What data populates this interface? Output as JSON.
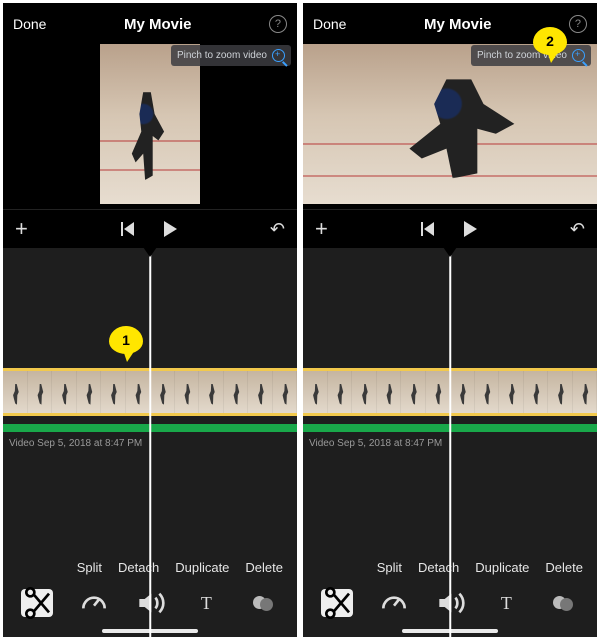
{
  "left": {
    "header": {
      "done": "Done",
      "title": "My Movie"
    },
    "preview": {
      "zoom_hint": "Pinch to zoom video",
      "orientation": "portrait"
    },
    "callout": {
      "num": "1"
    },
    "clip": {
      "meta": "Video Sep 5, 2018 at 8:47 PM"
    },
    "actions": {
      "split": "Split",
      "detach": "Detach",
      "duplicate": "Duplicate",
      "delete": "Delete"
    },
    "tools": {
      "text_tool": "T"
    }
  },
  "right": {
    "header": {
      "done": "Done",
      "title": "My Movie"
    },
    "preview": {
      "zoom_hint": "Pinch to zoom video",
      "orientation": "landscape"
    },
    "callout": {
      "num": "2"
    },
    "clip": {
      "meta": "Video Sep 5, 2018 at 8:47 PM"
    },
    "actions": {
      "split": "Split",
      "detach": "Detach",
      "duplicate": "Duplicate",
      "delete": "Delete"
    },
    "tools": {
      "text_tool": "T"
    }
  }
}
